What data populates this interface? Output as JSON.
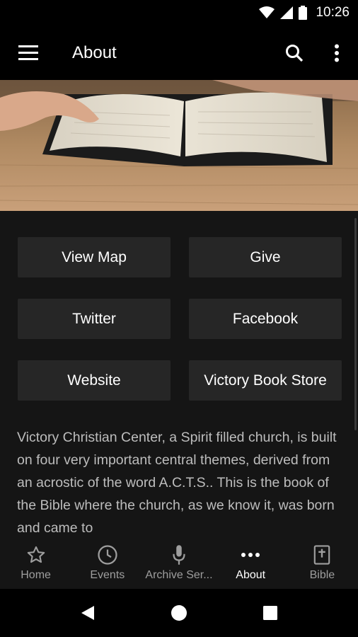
{
  "status_bar": {
    "time": "10:26",
    "icons": [
      "wifi-icon",
      "signal-icon",
      "battery-icon"
    ]
  },
  "app_bar": {
    "title": "About",
    "icons": {
      "menu": "hamburger-menu-icon",
      "search": "search-icon",
      "overflow": "more-vert-icon"
    }
  },
  "hero": {
    "image": "open-bible-on-wooden-table"
  },
  "buttons": {
    "view_map": "View Map",
    "give": "Give",
    "twitter": "Twitter",
    "facebook": "Facebook",
    "website": "Website",
    "book_store": "Victory Book Store"
  },
  "about_text": "Victory Christian Center, a Spirit filled church, is built on four very important central themes, derived from an acrostic of the word A.C.T.S.. This is the book of the Bible where the church, as we know it, was born and came to",
  "bottom_nav": {
    "items": [
      {
        "label": "Home",
        "icon": "star-icon"
      },
      {
        "label": "Events",
        "icon": "clock-icon"
      },
      {
        "label": "Archive Ser...",
        "icon": "microphone-icon"
      },
      {
        "label": "About",
        "icon": "more-horiz-icon"
      },
      {
        "label": "Bible",
        "icon": "bible-icon"
      }
    ],
    "active": "About"
  },
  "colors": {
    "background": "#121212",
    "app_bar": "#000000",
    "button": "#262626",
    "text_secondary": "#bdbdbd",
    "nav_inactive": "#9e9e9e"
  }
}
